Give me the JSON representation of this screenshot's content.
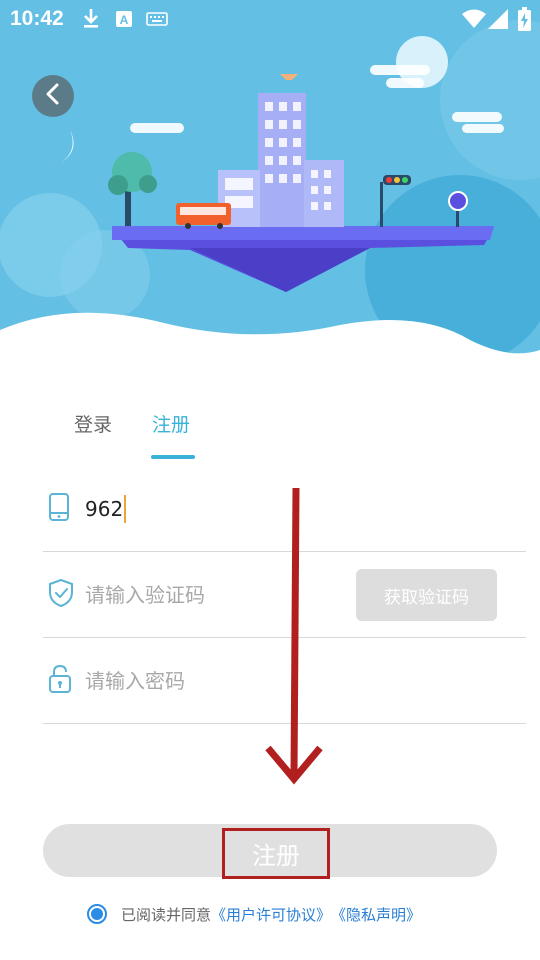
{
  "status_bar": {
    "time": "10:42",
    "icons": [
      "download-icon",
      "text-input-icon",
      "keyboard-icon",
      "wifi-icon",
      "signal-icon",
      "battery-charging-icon"
    ]
  },
  "header": {
    "back_icon": "chevron-left-icon",
    "illustration": "city-floating-island"
  },
  "tabs": [
    {
      "label": "登录",
      "active": false
    },
    {
      "label": "注册",
      "active": true
    }
  ],
  "form": {
    "phone": {
      "icon": "phone-icon",
      "value": "962"
    },
    "code": {
      "icon": "shield-check-icon",
      "placeholder": "请输入验证码",
      "button_label": "获取验证码"
    },
    "password": {
      "icon": "lock-icon",
      "placeholder": "请输入密码"
    }
  },
  "submit": {
    "label": "注册"
  },
  "agreement": {
    "checked": true,
    "text": "已阅读并同意",
    "user_agreement": "《用户许可协议》",
    "privacy": "《隐私声明》"
  },
  "colors": {
    "accent": "#3ab2d8",
    "hero_bg": "#63bfe3",
    "annotation": "#b21f1f",
    "link": "#2a7fd4"
  }
}
